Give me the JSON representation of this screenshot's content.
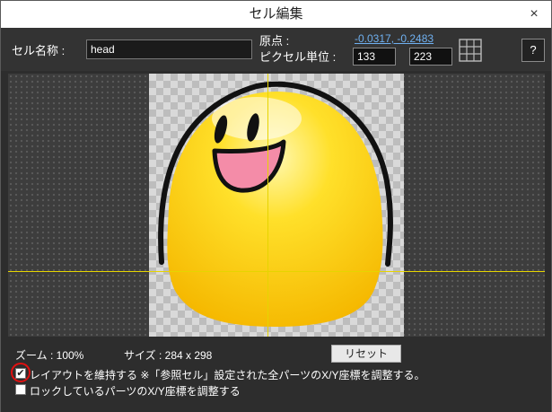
{
  "window": {
    "title": "セル編集",
    "close_glyph": "×"
  },
  "toolbar": {
    "cell_name_label": "セル名称 :",
    "cell_name_value": "head",
    "origin_label": "原点 :",
    "origin_value": "-0.0317, -0.2483",
    "pixel_unit_label": "ピクセル単位 :",
    "pixel_x": "133",
    "pixel_y": "223",
    "help_label": "?"
  },
  "status": {
    "zoom_text": "ズーム : 100%",
    "size_text": "サイズ : 284 x 298",
    "reset_label": "リセット",
    "keep_layout": {
      "checked": true,
      "label": "レイアウトを維持する ※「参照セル」設定された全パーツのX/Y座標を調整する。"
    },
    "locked_parts": {
      "checked": false,
      "label": "ロックしているパーツのX/Y座標を調整する"
    }
  },
  "colors": {
    "guide_line": "#e6d400",
    "face_fill": "#ffd000",
    "highlight_ring": "#e01010",
    "link": "#6fb0f0"
  },
  "icons": {
    "grid": "grid-icon",
    "checkbox": "checkmark-icon"
  }
}
